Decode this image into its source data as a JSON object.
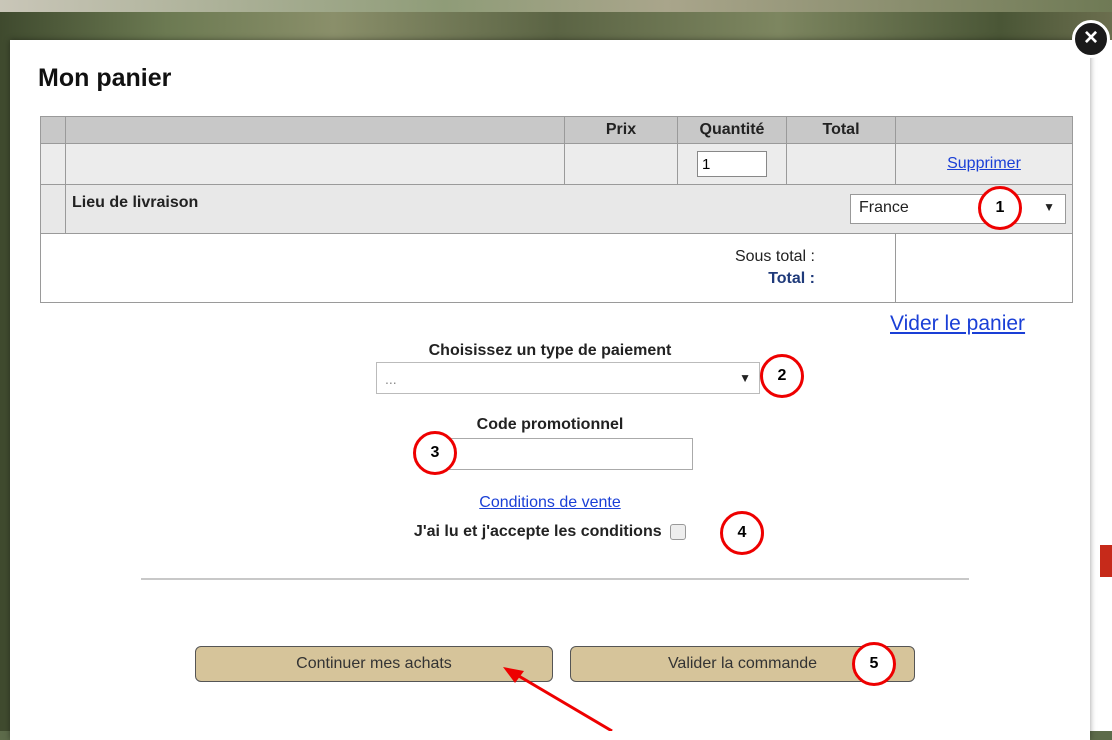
{
  "modal": {
    "title": "Mon panier",
    "close_glyph": "×"
  },
  "cart": {
    "columns": [
      "Prix",
      "Quantité",
      "Total"
    ],
    "item": {
      "quantity": "1",
      "remove_label": "Supprimer"
    },
    "shipping": {
      "label": "Lieu de livraison",
      "selected": "France"
    },
    "subtotal_label": "Sous total :",
    "total_label": "Total :",
    "empty_cart_label": "Vider le panier"
  },
  "payment": {
    "label": "Choisissez un type de paiement",
    "selected": "..."
  },
  "promo": {
    "label": "Code promotionnel",
    "value": ""
  },
  "terms": {
    "link_label": "Conditions de vente",
    "accept_label": "J'ai lu et j'accepte les conditions",
    "accepted": false
  },
  "buttons": {
    "continue_label": "Continuer mes achats",
    "validate_label": "Valider la commande"
  },
  "annotations": [
    "1",
    "2",
    "3",
    "4",
    "5"
  ],
  "colors": {
    "link": "#1a3fd6",
    "button_bg": "#d6c49a",
    "annotation": "#e00000"
  }
}
